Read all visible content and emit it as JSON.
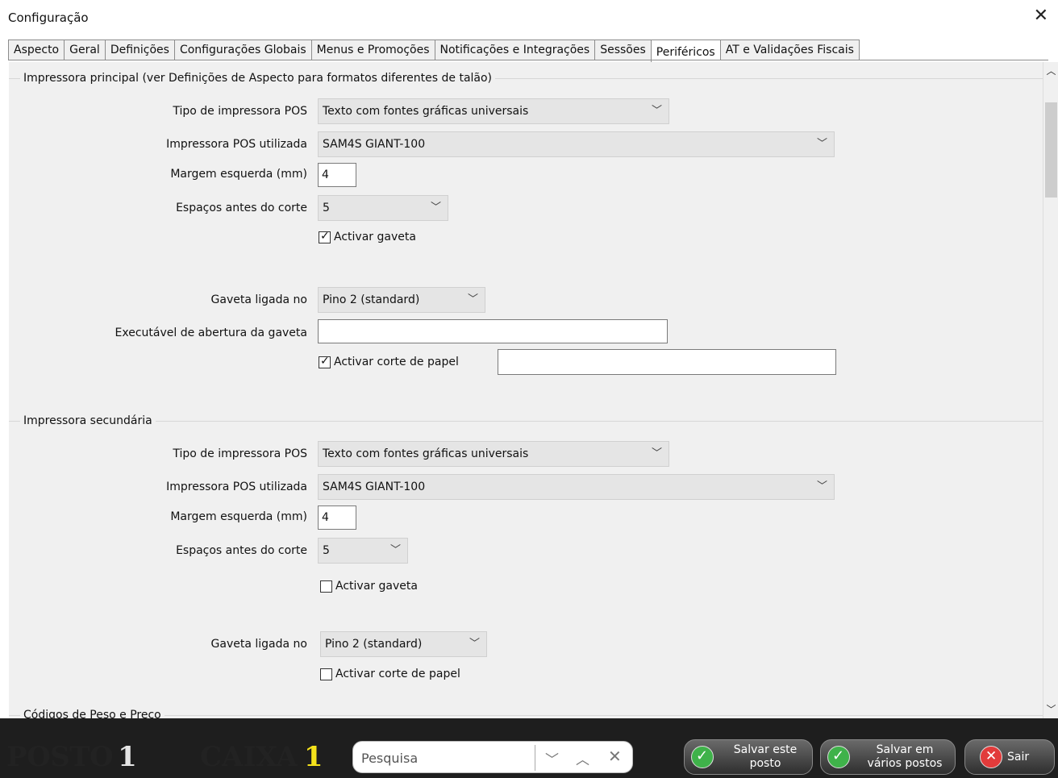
{
  "window": {
    "title": "Configuração"
  },
  "tabs": [
    "Aspecto",
    "Geral",
    "Definições",
    "Configurações Globais",
    "Menus e Promoções",
    "Notificações e Integrações",
    "Sessões",
    "Periféricos",
    "AT e Validações Fiscais"
  ],
  "active_tab": "Periféricos",
  "primary_printer": {
    "title": "Impressora principal (ver Definições de Aspecto para formatos diferentes de talão)",
    "pos_type_label": "Tipo de impressora POS",
    "pos_type_value": "Texto com fontes gráficas universais",
    "pos_used_label": "Impressora POS utilizada",
    "pos_used_value": "SAM4S GIANT-100",
    "margin_label": "Margem esquerda (mm)",
    "margin_value": "4",
    "spaces_label": "Espaços antes do corte",
    "spaces_value": "5",
    "drawer_check_label": "Activar gaveta",
    "drawer_checked": true,
    "drawer_pin_label": "Gaveta ligada no",
    "drawer_pin_value": "Pino 2 (standard)",
    "drawer_exec_label": "Executável de abertura da gaveta",
    "drawer_exec_value": "",
    "cut_check_label": "Activar corte de papel",
    "cut_checked": true,
    "cut_value": ""
  },
  "secondary_printer": {
    "title": "Impressora secundária",
    "pos_type_label": "Tipo de impressora POS",
    "pos_type_value": "Texto com fontes gráficas universais",
    "pos_used_label": "Impressora POS utilizada",
    "pos_used_value": "SAM4S GIANT-100",
    "margin_label": "Margem esquerda (mm)",
    "margin_value": "4",
    "spaces_label": "Espaços antes do corte",
    "spaces_value": "5",
    "drawer_check_label": "Activar gaveta",
    "drawer_checked": false,
    "drawer_pin_label": "Gaveta ligada no",
    "drawer_pin_value": "Pino 2 (standard)",
    "cut_check_label": "Activar corte de papel",
    "cut_checked": false
  },
  "next_group_title": "Códigos de Peso e Preço",
  "footer": {
    "posto_label": "POSTO",
    "posto_num": "1",
    "caixa_label": "CAIXA",
    "caixa_num": "1",
    "search_placeholder": "Pesquisa",
    "save_this_line1": "Salvar este",
    "save_this_line2": "posto",
    "save_many_line1": "Salvar em",
    "save_many_line2": "vários postos",
    "exit_label": "Sair"
  },
  "colors": {
    "footer_bg": "#1e1e1e",
    "caixa_num": "#f5e21b",
    "ok_icon": "#3fb24a",
    "exit_icon": "#e23b3b"
  }
}
